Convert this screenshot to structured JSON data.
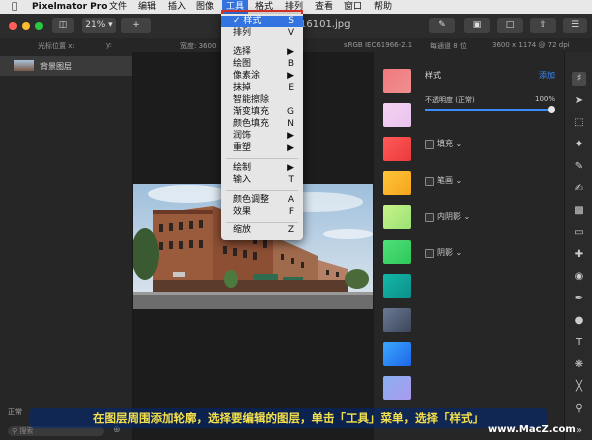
{
  "menubar": {
    "app_name": "Pixelmator Pro",
    "items": [
      "文件",
      "编辑",
      "插入",
      "图像",
      "工具",
      "格式",
      "排列",
      "查看",
      "窗口",
      "帮助"
    ]
  },
  "toolbar": {
    "zoom": "21%",
    "add": "+",
    "doc_title": "16101.jpg"
  },
  "infobar": {
    "cursor_x": "光标位置 x:",
    "cursor_y": "y:",
    "width": "宽度: 3600",
    "color_profile": "sRGB IEC61966-2.1",
    "bit_depth": "每通道 8 位",
    "dimensions": "3600 x 1174 @ 72 dpi"
  },
  "layers": {
    "items": [
      "背景图层"
    ],
    "blend_mode": "正常",
    "search_placeholder": "搜索"
  },
  "tools_menu": {
    "items": [
      {
        "label": "✓ 样式",
        "shortcut": "S",
        "selected": true
      },
      {
        "label": "排列",
        "shortcut": "V"
      },
      {
        "label": "选择",
        "shortcut": "▶"
      },
      {
        "label": "绘图",
        "shortcut": "B"
      },
      {
        "label": "像素涂",
        "shortcut": "▶"
      },
      {
        "label": "抹掉",
        "shortcut": "E"
      },
      {
        "label": "智能擦除",
        "shortcut": ""
      },
      {
        "label": "渐变填充",
        "shortcut": "G"
      },
      {
        "label": "颜色填充",
        "shortcut": "N"
      },
      {
        "label": "润饰",
        "shortcut": "▶"
      },
      {
        "label": "重塑",
        "shortcut": "▶"
      },
      {
        "label": "绘制",
        "shortcut": "▶"
      },
      {
        "label": "输入",
        "shortcut": "T"
      },
      {
        "label": "颜色调整",
        "shortcut": "A"
      },
      {
        "label": "效果",
        "shortcut": "F"
      },
      {
        "label": "缩放",
        "shortcut": "Z"
      }
    ]
  },
  "inspector": {
    "title": "样式",
    "add_link": "添加",
    "opacity_label": "不透明度 (正常)",
    "opacity_value": "100%",
    "opacity": 1.0,
    "sections": [
      "填充",
      "笔画",
      "内阴影",
      "阴影"
    ]
  },
  "swatches": {
    "colors": [
      [
        "#f0787e",
        "#ef8f8f"
      ],
      [
        "#f4d2f1",
        "#e8c3ef"
      ],
      [
        "#ff5a5a",
        "#ea3a3a"
      ],
      [
        "#ffc43a",
        "#f4a51c"
      ],
      [
        "#c7f38a",
        "#9be274"
      ],
      [
        "#4fe07a",
        "#2ec85a"
      ],
      [
        "#13b8a8",
        "#0d8f8a"
      ],
      [
        "#6a7a94",
        "#3c4658"
      ],
      [
        "#3aa8ff",
        "#1e66e8"
      ],
      [
        "#8ab0f0",
        "#aa99ee"
      ]
    ]
  },
  "caption": "在图层周围添加轮廓，选择要编辑的图层，单击「工具」菜单，选择「样式」",
  "watermark": "www.MacZ.com"
}
